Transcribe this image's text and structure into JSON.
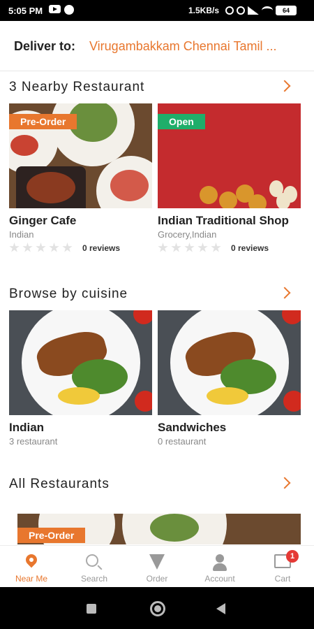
{
  "status_bar": {
    "time": "5:05 PM",
    "speed": "1.5KB/s",
    "battery": "64"
  },
  "header": {
    "deliver_label": "Deliver to:",
    "address": "Virugambakkam Chennai Tamil ..."
  },
  "nearby": {
    "title": "3 Nearby Restaurant",
    "cards": [
      {
        "name": "Ginger Cafe",
        "category": "Indian",
        "tag": "Pre-Order",
        "rating": 0,
        "reviews": "0 reviews"
      },
      {
        "name": "Indian Traditional Shop",
        "category": "Grocery,Indian",
        "tag": "Open",
        "rating": 0,
        "reviews": "0 reviews"
      }
    ]
  },
  "cuisine": {
    "title": "Browse by cuisine",
    "cards": [
      {
        "name": "Indian",
        "count": "3 restaurant"
      },
      {
        "name": "Sandwiches",
        "count": "0 restaurant"
      }
    ]
  },
  "all_restaurants": {
    "title": "All Restaurants",
    "first_card_tag": "Pre-Order"
  },
  "bottom_nav": {
    "items": [
      {
        "label": "Near Me",
        "icon": "location-pin-icon",
        "active": true
      },
      {
        "label": "Search",
        "icon": "search-icon",
        "active": false
      },
      {
        "label": "Order",
        "icon": "pizza-icon",
        "active": false
      },
      {
        "label": "Account",
        "icon": "user-icon",
        "active": false
      },
      {
        "label": "Cart",
        "icon": "cart-icon",
        "active": false
      }
    ],
    "cart_badge": "1"
  },
  "colors": {
    "accent": "#e8772e",
    "open_tag": "#1fae6a",
    "badge": "#e53935"
  }
}
